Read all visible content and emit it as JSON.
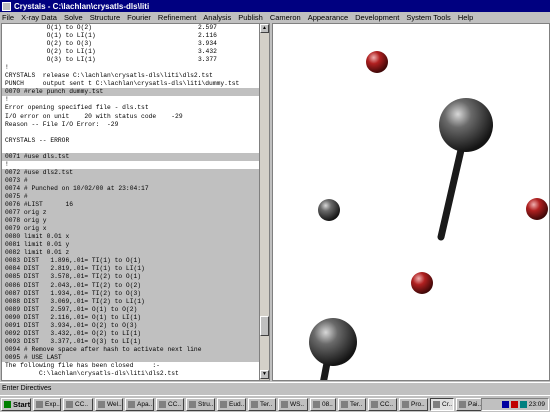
{
  "window": {
    "title": "Crystals - C:\\lachlan\\crysatls-dls\\liti"
  },
  "menu": [
    "File",
    "X-ray Data",
    "Solve",
    "Structure",
    "Fourier",
    "Refinement",
    "Analysis",
    "Publish",
    "Cameron",
    "Appearance",
    "Development",
    "System Tools",
    "Help"
  ],
  "text_lines": [
    {
      "t": "           O(1) to O(2)",
      "v": "2.597",
      "hl": false
    },
    {
      "t": "           O(1) to LI(1)",
      "v": "2.116",
      "hl": false
    },
    {
      "t": "           O(2) to O(3)",
      "v": "3.934",
      "hl": false
    },
    {
      "t": "           O(2) to LI(1)",
      "v": "3.432",
      "hl": false
    },
    {
      "t": "           O(3) to LI(1)",
      "v": "3.377",
      "hl": false
    },
    {
      "t": "!",
      "v": "",
      "hl": false
    },
    {
      "t": "CRYSTALS  release C:\\lachlan\\crysatls-dls\\liti\\dls2.tst",
      "v": "",
      "hl": false
    },
    {
      "t": "PUNCH     output sent t C:\\lachlan\\crysatls-dls\\liti\\dummy.tst",
      "v": "",
      "hl": false
    },
    {
      "t": "0070 #rele punch dummy.tst",
      "v": "",
      "hl": true
    },
    {
      "t": "!",
      "v": "",
      "hl": false
    },
    {
      "t": "Error opening specified file - dls.tst",
      "v": "",
      "hl": false
    },
    {
      "t": "I/O error on unit    20 with status code    -29",
      "v": "",
      "hl": false
    },
    {
      "t": "Reason -- File I/O Error:  -29",
      "v": "",
      "hl": false
    },
    {
      "t": "",
      "v": "",
      "hl": false
    },
    {
      "t": "CRYSTALS -- ERROR",
      "v": "",
      "hl": false
    },
    {
      "t": "",
      "v": "",
      "hl": false
    },
    {
      "t": "0071 #use dls.tst",
      "v": "",
      "hl": true
    },
    {
      "t": "!",
      "v": "",
      "hl": false
    },
    {
      "t": "0072 #use dls2.tst",
      "v": "",
      "hl": true
    },
    {
      "t": "0073 #",
      "v": "",
      "hl": true
    },
    {
      "t": "0074 # Punched on 10/02/00 at 23:04:17",
      "v": "",
      "hl": true
    },
    {
      "t": "0075 #",
      "v": "",
      "hl": true
    },
    {
      "t": "0076 #LIST      16",
      "v": "",
      "hl": true
    },
    {
      "t": "0077 orig z",
      "v": "",
      "hl": true
    },
    {
      "t": "0078 orig y",
      "v": "",
      "hl": true
    },
    {
      "t": "0079 orig x",
      "v": "",
      "hl": true
    },
    {
      "t": "0080 limit 0.01 x",
      "v": "",
      "hl": true
    },
    {
      "t": "0081 limit 0.01 y",
      "v": "",
      "hl": true
    },
    {
      "t": "0082 limit 0.01 z",
      "v": "",
      "hl": true
    },
    {
      "t": "0083 DIST   1.896,.01= TI(1) to O(1)",
      "v": "",
      "hl": true
    },
    {
      "t": "0084 DIST   2.819,.01= TI(1) to LI(1)",
      "v": "",
      "hl": true
    },
    {
      "t": "0085 DIST   3.578,.01= TI(2) to O(1)",
      "v": "",
      "hl": true
    },
    {
      "t": "0086 DIST   2.043,.01= TI(2) to O(2)",
      "v": "",
      "hl": true
    },
    {
      "t": "0087 DIST   1.934,.01= TI(2) to O(3)",
      "v": "",
      "hl": true
    },
    {
      "t": "0088 DIST   3.069,.01= TI(2) to LI(1)",
      "v": "",
      "hl": true
    },
    {
      "t": "0089 DIST   2.597,.01= O(1) to O(2)",
      "v": "",
      "hl": true
    },
    {
      "t": "0090 DIST   2.116,.01= O(1) to LI(1)",
      "v": "",
      "hl": true
    },
    {
      "t": "0091 DIST   3.934,.01= O(2) to O(3)",
      "v": "",
      "hl": true
    },
    {
      "t": "0092 DIST   3.432,.01= O(2) to LI(1)",
      "v": "",
      "hl": true
    },
    {
      "t": "0093 DIST   3.377,.01= O(3) to LI(1)",
      "v": "",
      "hl": true
    },
    {
      "t": "0094 # Remove space after hash to activate next line",
      "v": "",
      "hl": true
    },
    {
      "t": "0095 # USE LAST",
      "v": "",
      "hl": true
    },
    {
      "t": "The following file has been closed     :-",
      "v": "",
      "hl": false
    },
    {
      "t": "         C:\\lachlan\\crysatls-dls\\liti\\dls2.tst",
      "v": "",
      "hl": false
    },
    {
      "t": "",
      "v": "",
      "hl": false
    },
    {
      "t": ">",
      "v": "",
      "hl": false
    }
  ],
  "command_bar": {
    "label": "Enter Directives"
  },
  "taskbar": {
    "start_label": "Start",
    "buttons": [
      "Exp..",
      "CC..",
      "Wel..",
      "Apa..",
      "CC..",
      "Stru..",
      "Eud..",
      "Ter..",
      "WS..",
      "08..",
      "Ter..",
      "CC..",
      "Pro..",
      "Cr..",
      "Pai.."
    ],
    "active_index": 13,
    "clock": "23:09"
  },
  "colors": {
    "titlebar": "#000080",
    "sphere_dark": "#3a3a3a",
    "sphere_red": "#a01818"
  }
}
